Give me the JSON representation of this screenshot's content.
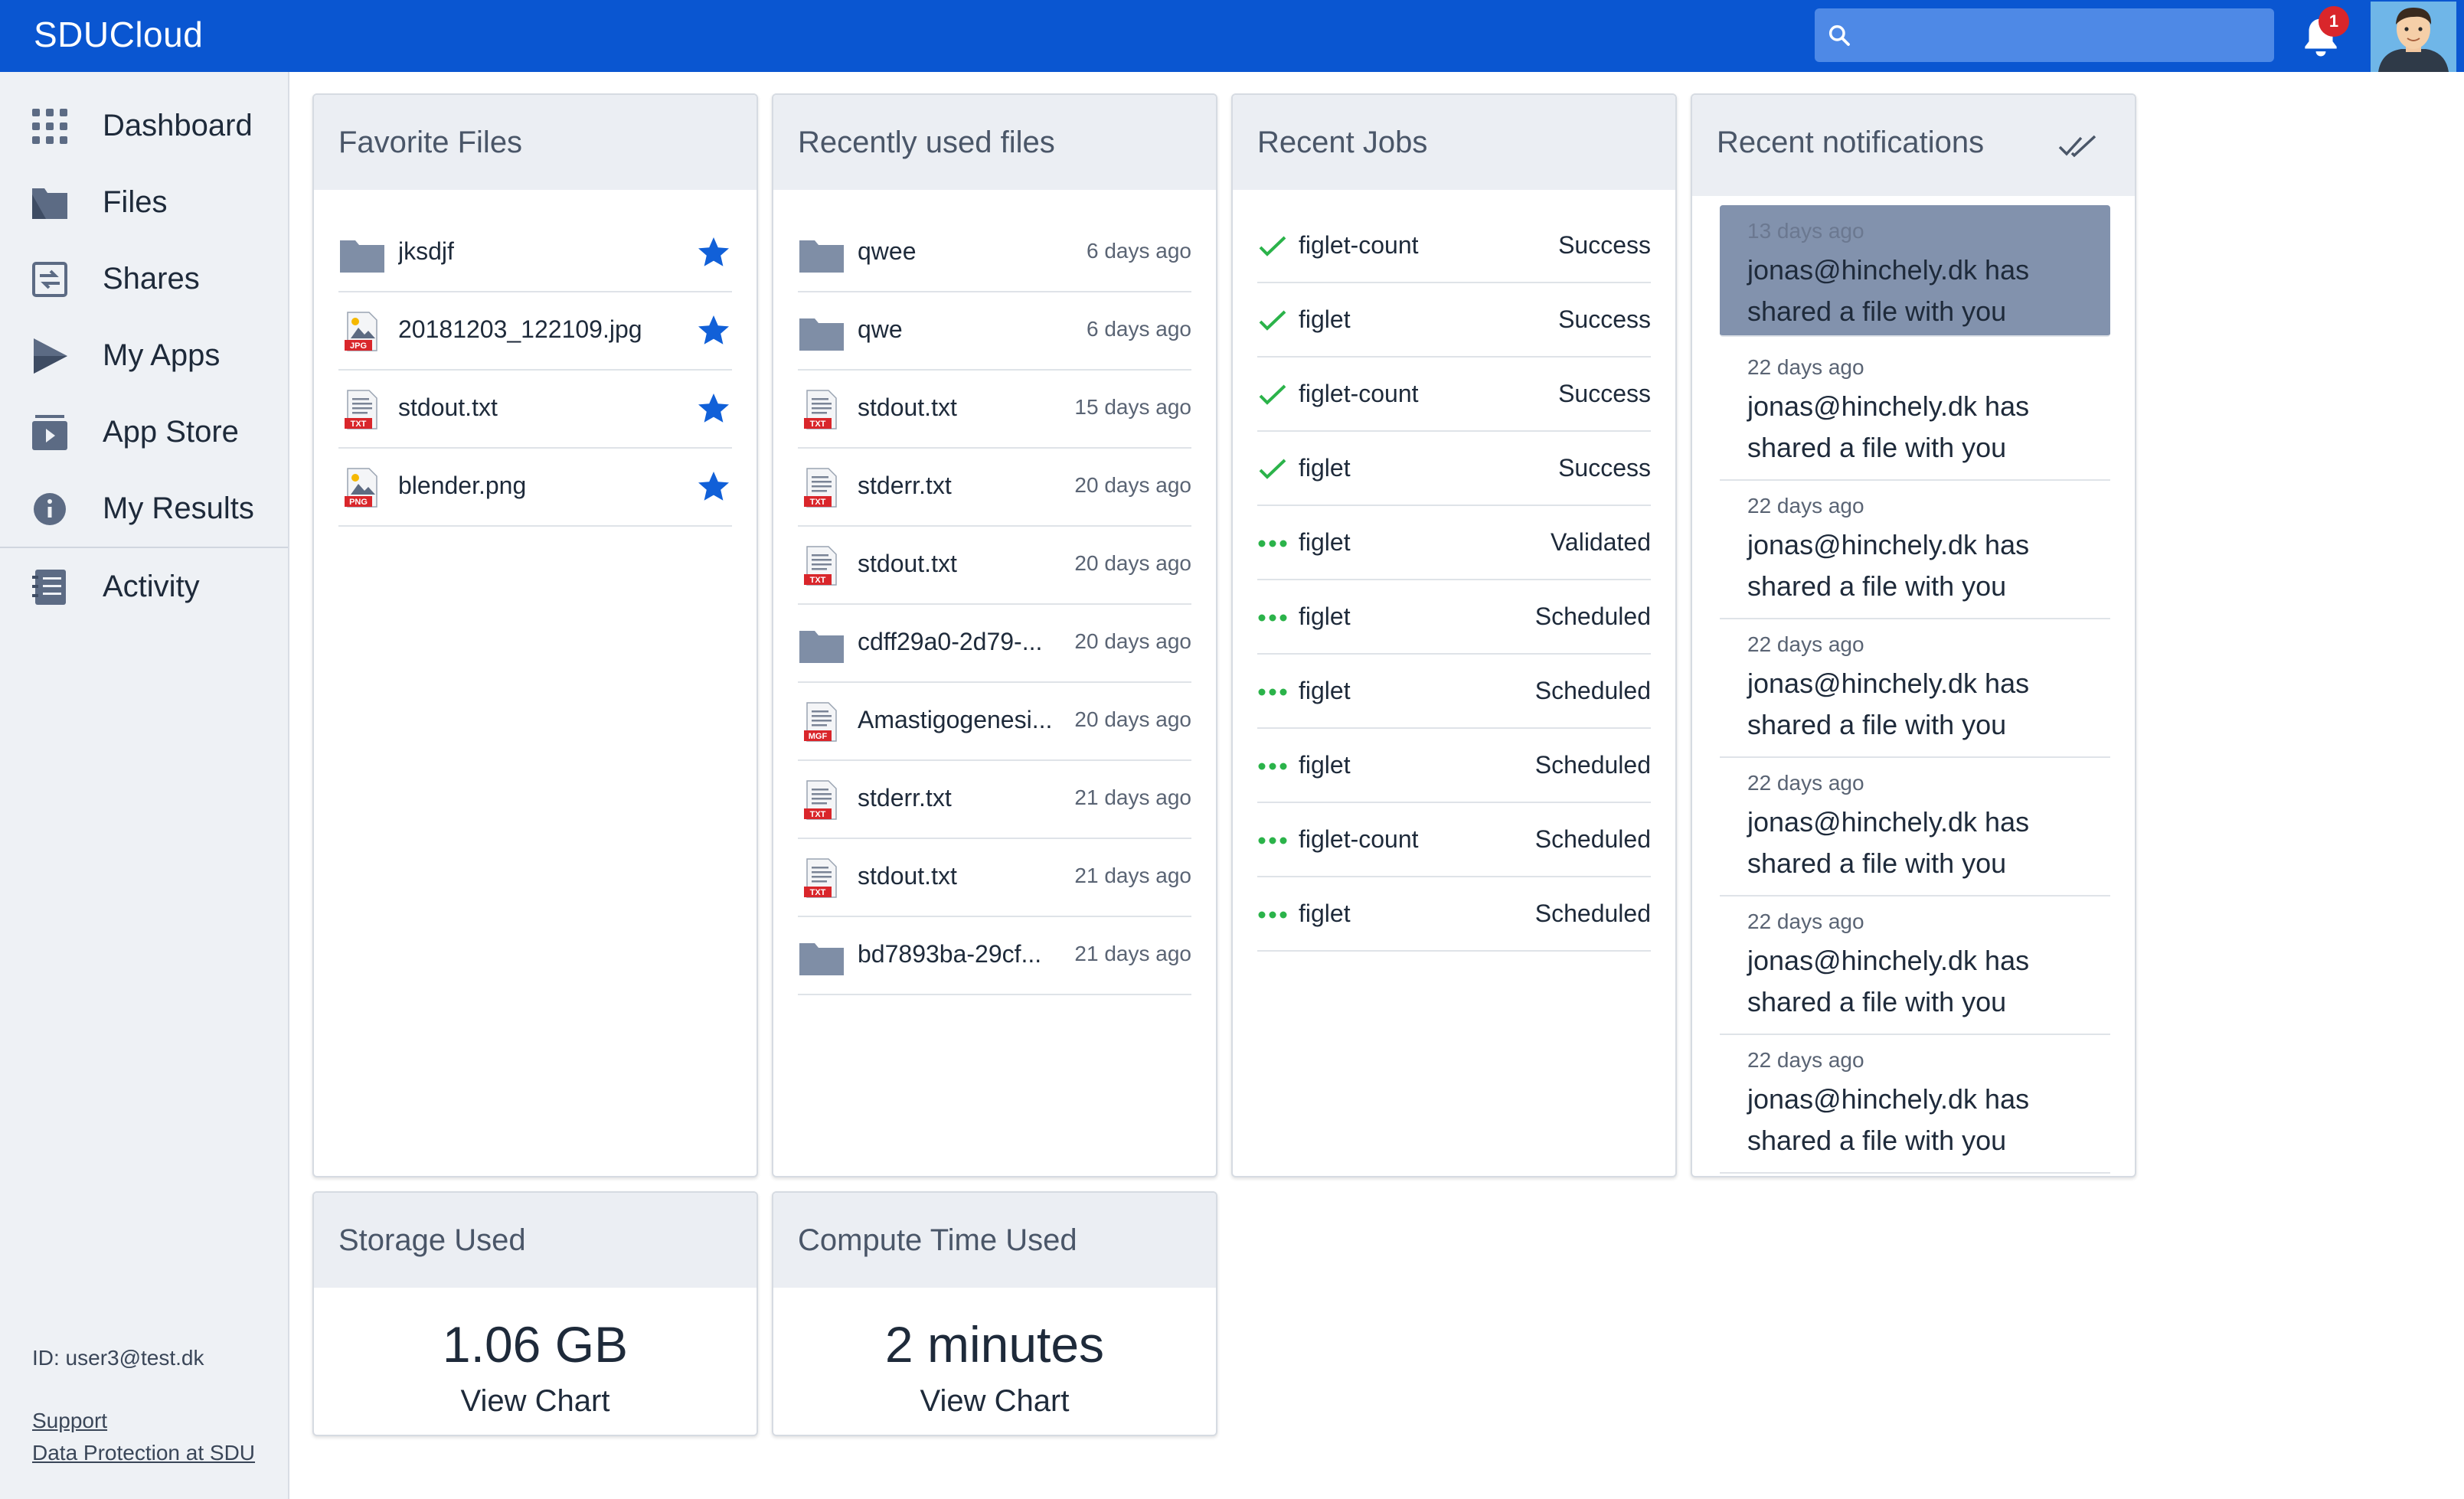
{
  "header": {
    "brand": "SDUCloud",
    "search_placeholder": "",
    "notification_count": "1"
  },
  "sidebar": {
    "items": [
      {
        "label": "Dashboard",
        "icon": "dashboard-grid-icon"
      },
      {
        "label": "Files",
        "icon": "folder-icon"
      },
      {
        "label": "Shares",
        "icon": "share-icon"
      },
      {
        "label": "My Apps",
        "icon": "play-icon"
      },
      {
        "label": "App Store",
        "icon": "app-store-icon"
      },
      {
        "label": "My Results",
        "icon": "info-icon"
      },
      {
        "label": "Activity",
        "icon": "activity-list-icon"
      }
    ],
    "user_id": "ID: user3@test.dk",
    "support": "Support",
    "data_protection": "Data Protection at SDU"
  },
  "favorites": {
    "title": "Favorite Files",
    "items": [
      {
        "name": "jksdjf",
        "type": "folder"
      },
      {
        "name": "20181203_122109.jpg",
        "type": "JPG"
      },
      {
        "name": "stdout.txt",
        "type": "TXT"
      },
      {
        "name": "blender.png",
        "type": "PNG"
      }
    ]
  },
  "recent_files": {
    "title": "Recently used files",
    "items": [
      {
        "name": "qwee",
        "type": "folder",
        "ago": "6 days ago"
      },
      {
        "name": "qwe",
        "type": "folder",
        "ago": "6 days ago"
      },
      {
        "name": "stdout.txt",
        "type": "TXT",
        "ago": "15 days ago"
      },
      {
        "name": "stderr.txt",
        "type": "TXT",
        "ago": "20 days ago"
      },
      {
        "name": "stdout.txt",
        "type": "TXT",
        "ago": "20 days ago"
      },
      {
        "name": "cdff29a0-2d79-...",
        "type": "folder",
        "ago": "20 days ago"
      },
      {
        "name": "Amastigogenesi...",
        "type": "MGF",
        "ago": "20 days ago"
      },
      {
        "name": "stderr.txt",
        "type": "TXT",
        "ago": "21 days ago"
      },
      {
        "name": "stdout.txt",
        "type": "TXT",
        "ago": "21 days ago"
      },
      {
        "name": "bd7893ba-29cf...",
        "type": "folder",
        "ago": "21 days ago"
      }
    ]
  },
  "jobs": {
    "title": "Recent Jobs",
    "items": [
      {
        "name": "figlet-count",
        "status": "Success",
        "icon": "check-icon"
      },
      {
        "name": "figlet",
        "status": "Success",
        "icon": "check-icon"
      },
      {
        "name": "figlet-count",
        "status": "Success",
        "icon": "check-icon"
      },
      {
        "name": "figlet",
        "status": "Success",
        "icon": "check-icon"
      },
      {
        "name": "figlet",
        "status": "Validated",
        "icon": "dots-icon"
      },
      {
        "name": "figlet",
        "status": "Scheduled",
        "icon": "dots-icon"
      },
      {
        "name": "figlet",
        "status": "Scheduled",
        "icon": "dots-icon"
      },
      {
        "name": "figlet",
        "status": "Scheduled",
        "icon": "dots-icon"
      },
      {
        "name": "figlet-count",
        "status": "Scheduled",
        "icon": "dots-icon"
      },
      {
        "name": "figlet",
        "status": "Scheduled",
        "icon": "dots-icon"
      }
    ]
  },
  "notifications": {
    "title": "Recent notifications",
    "items": [
      {
        "time": "13 days ago",
        "message": "jonas@hinchely.dk has shared a file with you"
      },
      {
        "time": "22 days ago",
        "message": "jonas@hinchely.dk has shared a file with you"
      },
      {
        "time": "22 days ago",
        "message": "jonas@hinchely.dk has shared a file with you"
      },
      {
        "time": "22 days ago",
        "message": "jonas@hinchely.dk has shared a file with you"
      },
      {
        "time": "22 days ago",
        "message": "jonas@hinchely.dk has shared a file with you"
      },
      {
        "time": "22 days ago",
        "message": "jonas@hinchely.dk has shared a file with you"
      },
      {
        "time": "22 days ago",
        "message": "jonas@hinchely.dk has shared a file with you"
      }
    ]
  },
  "storage": {
    "title": "Storage Used",
    "value": "1.06 GB",
    "link": "View Chart"
  },
  "compute": {
    "title": "Compute Time Used",
    "value": "2 minutes",
    "link": "View Chart"
  },
  "colors": {
    "header": "#0a56d1",
    "star": "#1160d8",
    "success": "#2bb34a",
    "folder": "#7f8ea6",
    "file_badge": "#d9262b"
  }
}
